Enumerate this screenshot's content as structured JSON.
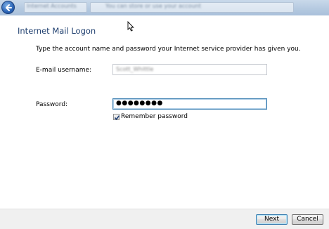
{
  "titlebar": {
    "back_icon": "back-arrow-icon",
    "blurred_address_1": "Internet Accounts",
    "blurred_address_2": "You can store or use your account"
  },
  "dialog": {
    "title": "Internet Mail Logon",
    "instruction": "Type the account name and password your Internet service provider has given you.",
    "username_label": "E-mail username:",
    "username_value": "Scott_Whittle",
    "password_label": "Password:",
    "password_value": "●●●●●●●●",
    "remember_label": "Remember password",
    "remember_checked": true
  },
  "footer": {
    "next_label": "Next",
    "cancel_label": "Cancel"
  },
  "colors": {
    "title_color": "#1f3f6f",
    "focus_border": "#3c7fb1"
  }
}
